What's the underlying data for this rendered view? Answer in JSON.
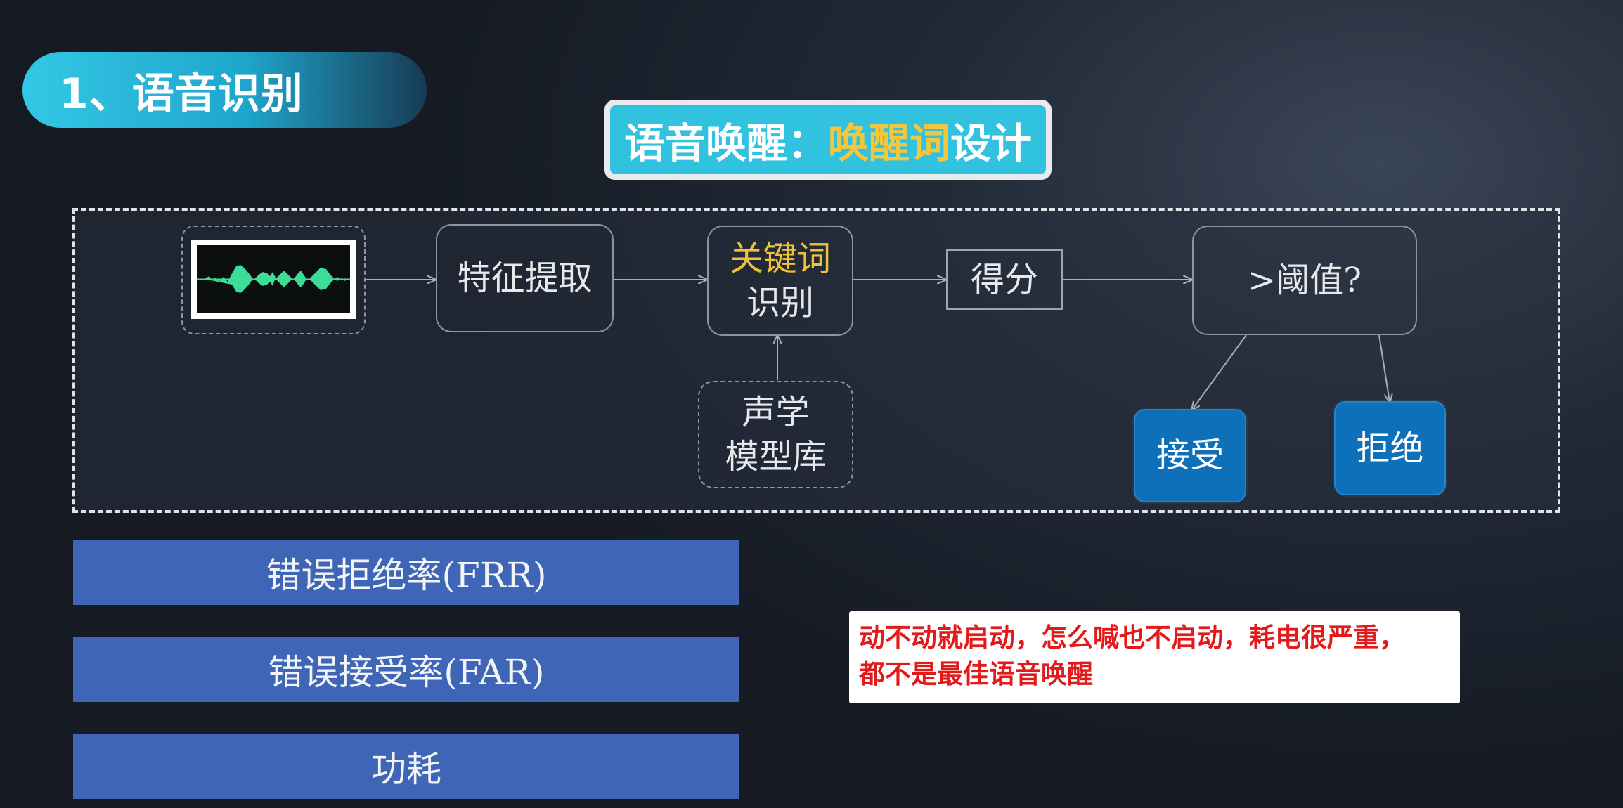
{
  "section": {
    "label": "1、语音识别"
  },
  "title": {
    "prefix": "语音唤醒：",
    "highlight": "唤醒词",
    "suffix": "设计"
  },
  "flow": {
    "feature": "特征提取",
    "keyword_line1": "关键词",
    "keyword_line2": "识别",
    "score": "得分",
    "threshold": ">阈值?",
    "acoustic_line1": "声学",
    "acoustic_line2": "模型库",
    "accept": "接受",
    "reject": "拒绝"
  },
  "metrics": [
    {
      "label": "错误拒绝率(FRR)"
    },
    {
      "label": "错误接受率(FAR)"
    },
    {
      "label": "功耗"
    }
  ],
  "note": {
    "line1": "动不动就启动，怎么喊也不启动，耗电很严重，",
    "line2": "都不是最佳语音唤醒"
  },
  "colors": {
    "accent_cyan": "#31c2df",
    "keyword_yellow": "#f0c23a",
    "metric_blue": "#3f66b6",
    "decision_blue": "#0e70b8",
    "note_red": "#e41a1a",
    "waveform_green": "#3ddc97"
  }
}
